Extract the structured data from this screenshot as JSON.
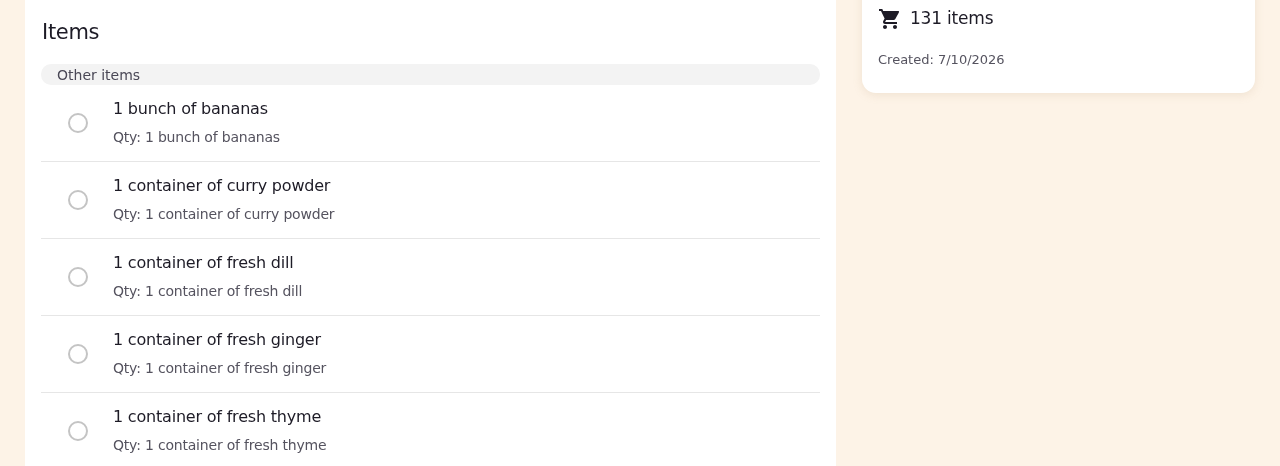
{
  "items_panel": {
    "title": "Items",
    "group": "Other items",
    "items": [
      {
        "name": "1 bunch of bananas",
        "qty": "Qty: 1 bunch of bananas",
        "checked": false
      },
      {
        "name": "1 container of curry powder",
        "qty": "Qty: 1 container of curry powder",
        "checked": false
      },
      {
        "name": "1 container of fresh dill",
        "qty": "Qty: 1 container of fresh dill",
        "checked": false
      },
      {
        "name": "1 container of fresh ginger",
        "qty": "Qty: 1 container of fresh ginger",
        "checked": false
      },
      {
        "name": "1 container of fresh thyme",
        "qty": "Qty: 1 container of fresh thyme",
        "checked": false
      }
    ]
  },
  "summary": {
    "count": "131 items",
    "created": "Created: 7/10/2026"
  }
}
